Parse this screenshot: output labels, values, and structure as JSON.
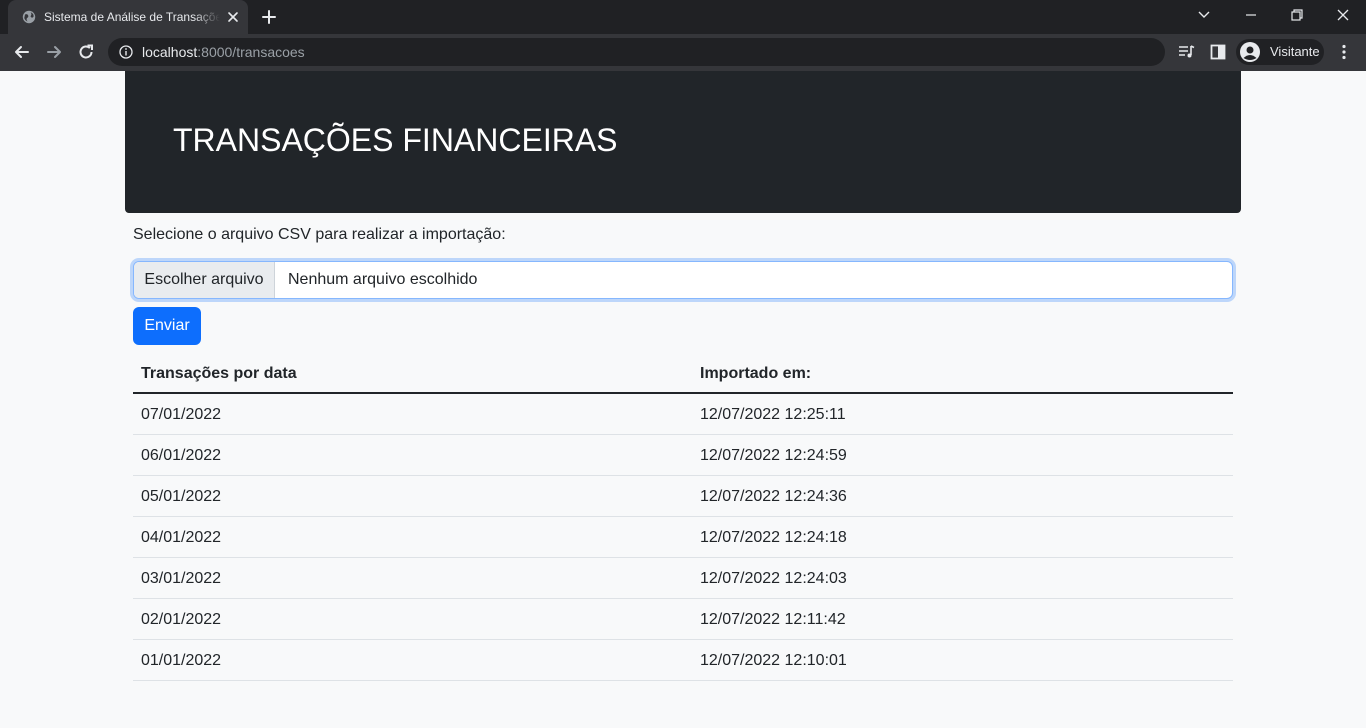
{
  "browser": {
    "tab_title": "Sistema de Análise de Transações",
    "url_host": "localhost",
    "url_path": ":8000/transacoes",
    "profile_name": "Visitante"
  },
  "page": {
    "heading": "TRANSAÇÕES FINANCEIRAS",
    "select_label": "Selecione o arquivo CSV para realizar a importação:",
    "file_button_label": "Escolher arquivo",
    "file_status": "Nenhum arquivo escolhido",
    "submit_label": "Enviar"
  },
  "table": {
    "headers": [
      "Transações por data",
      "Importado em:"
    ],
    "rows": [
      [
        "07/01/2022",
        "12/07/2022 12:25:11"
      ],
      [
        "06/01/2022",
        "12/07/2022 12:24:59"
      ],
      [
        "05/01/2022",
        "12/07/2022 12:24:36"
      ],
      [
        "04/01/2022",
        "12/07/2022 12:24:18"
      ],
      [
        "03/01/2022",
        "12/07/2022 12:24:03"
      ],
      [
        "02/01/2022",
        "12/07/2022 12:11:42"
      ],
      [
        "01/01/2022",
        "12/07/2022 12:10:01"
      ]
    ]
  },
  "colors": {
    "accent": "#0d6efd",
    "hero_bg": "#212529",
    "page_bg": "#f8f9fa"
  }
}
